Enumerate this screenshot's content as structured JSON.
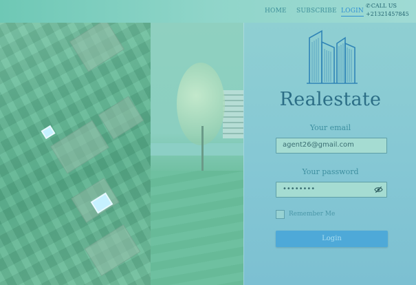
{
  "nav": {
    "home": "HOME",
    "subscribe": "SUBSCRIBE",
    "login": "LOGIN",
    "call_label": "CALL US",
    "phone": "+21321457845",
    "icon": "phone-icon"
  },
  "brand": {
    "name": "Realestate",
    "logo": "city-buildings-logo"
  },
  "form": {
    "email_label": "Your email",
    "email_value": "agent26@gmail.com",
    "password_label": "Your password",
    "password_value": "••••••••",
    "password_toggle_icon": "eye-slash-icon",
    "remember_label": "Remember Me",
    "remember_checked": false,
    "submit_label": "Login"
  },
  "colors": {
    "accent": "#2f8fd2",
    "button": "#4ea9d8",
    "brand_text": "#2c6e86"
  }
}
